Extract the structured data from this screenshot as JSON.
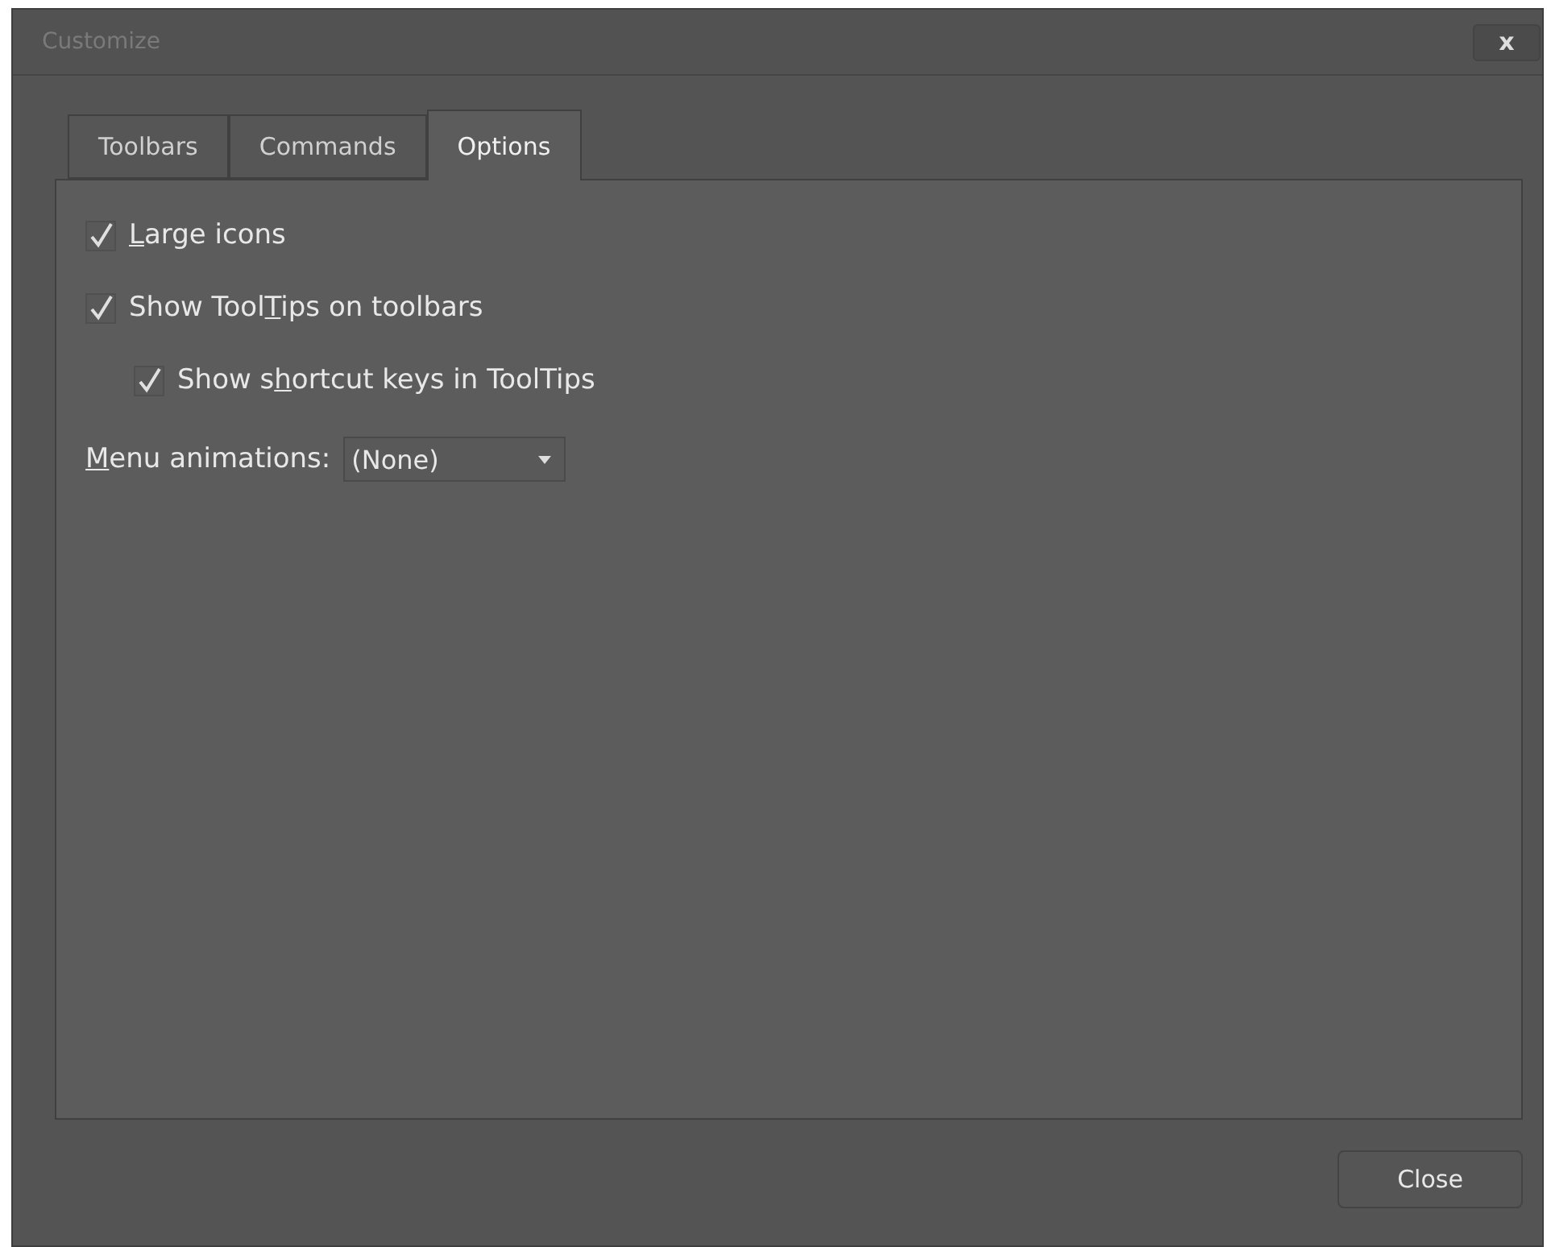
{
  "window": {
    "title": "Customize",
    "close_glyph": "x"
  },
  "tabs": [
    {
      "label": "Toolbars",
      "selected": false
    },
    {
      "label": "Commands",
      "selected": false
    },
    {
      "label": "Options",
      "selected": true
    }
  ],
  "options": [
    {
      "kind": "checkbox",
      "access_key": "L",
      "label_post": "arge icons",
      "checked": true
    },
    {
      "kind": "checkbox",
      "label_pre": "Show Tool",
      "access_key": "T",
      "label_post": "ips on toolbars",
      "checked": true,
      "children": [
        {
          "kind": "checkbox",
          "label_pre": "Show s",
          "access_key": "h",
          "label_post": "ortcut keys in ToolTips",
          "checked": true
        }
      ]
    },
    {
      "kind": "dropdown",
      "access_key": "M",
      "label_post": "enu animations:",
      "value": "(None)"
    }
  ],
  "buttons": [
    {
      "label": "Close"
    }
  ]
}
